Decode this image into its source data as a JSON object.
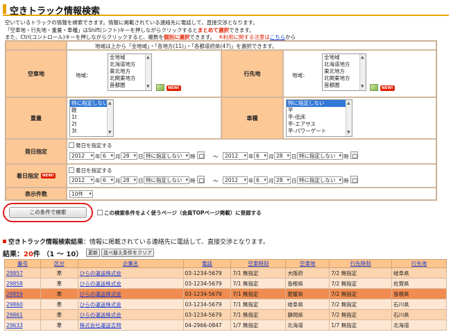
{
  "page_title": "空きトラック情報検索",
  "intro": {
    "line1": "空いているトラックの情報を検索できます。情報に掲載されている連絡先に電話して、直接交渉となります。",
    "line2_a": "「空車地・行先地・重量・車種」はShift(シフト)キーを押しながらクリックすると",
    "line2_b": "まとめて選択",
    "line2_c": "できます。",
    "line3_a": "また、Ctrl(コントロール)キーを押しながらクリックすると、複数を",
    "line3_b": "個別に選択",
    "line3_c": "できます。",
    "line3_note": "※利用に関する注意は",
    "line3_link": "こちら",
    "line3_end": "から"
  },
  "form": {
    "region_note": "地域は上から「全地域」・「各地方(11)」・「各都道府県(47)」を選択できます。",
    "new_badge": "NEW!",
    "origin": {
      "label": "空車地",
      "sub_label": "地域：",
      "options": [
        "全地域",
        "北海道地方",
        "東北地方",
        "北関東地方",
        "首都圏"
      ]
    },
    "destination": {
      "label": "行先地",
      "sub_label": "地域：",
      "options": [
        "全地域",
        "北海道地方",
        "東北地方",
        "北関東地方",
        "首都圏"
      ]
    },
    "weight": {
      "label": "重量",
      "options": [
        "特に指定しない",
        "軽",
        "1t",
        "2t",
        "3t"
      ],
      "selected": 0
    },
    "vehicle": {
      "label": "車種",
      "options": [
        "特に指定しない",
        "平",
        "平-低床",
        "平-エアサス",
        "平-パワーゲート"
      ],
      "selected": 0
    },
    "departure": {
      "label": "発日指定",
      "checkbox": "発日を指定する",
      "from": {
        "year": "2012",
        "month": "6",
        "day": "28",
        "time": "特に指定しない"
      },
      "to": {
        "year": "2012",
        "month": "6",
        "day": "28",
        "time": "特に指定しない"
      }
    },
    "arrival": {
      "label": "着日指定",
      "checkbox": "着日を指定する",
      "from": {
        "year": "2012",
        "month": "6",
        "day": "28",
        "time": "特に指定しない"
      },
      "to": {
        "year": "2012",
        "month": "6",
        "day": "28",
        "time": "特に指定しない"
      }
    },
    "units": {
      "year": "年",
      "month": "月",
      "day": "日",
      "hour": "時",
      "tilde": "～"
    },
    "count": {
      "label": "表示件数",
      "value": "10件"
    }
  },
  "search_button": "この条件で検索",
  "save_checkbox": "この検索条件をよく使うページ（会員TOPページ掲載）に登録する",
  "results": {
    "title_bold": "空きトラック情報検索結果",
    "title_rest": "：情報に掲載されている連絡先に電話して、直接交渉となります。",
    "count_prefix": "結果：",
    "count": "20",
    "count_unit": "件",
    "range": "（1 ～ 10）",
    "refresh": "更新",
    "clear_sort": "並べ替え条件をクリア",
    "headers": [
      "番号",
      "区分",
      "企業名",
      "電話",
      "空車時刻",
      "空車地",
      "行先時刻",
      "行先地"
    ],
    "rows": [
      [
        "29857",
        "準",
        "ひらの運送株式会",
        "03-1234-5679",
        "7/1 無指定",
        "大阪府",
        "7/2 無指定",
        "岐阜県"
      ],
      [
        "29858",
        "準",
        "ひらの運送株式会",
        "03-1234-5679",
        "7/1 無指定",
        "島根県",
        "7/2 無指定",
        "佐賀県"
      ],
      [
        "29859",
        "準",
        "ひらの運送株式会",
        "03-1234-5679",
        "7/1 無指定",
        "愛媛県",
        "7/2 無指定",
        "島根県"
      ],
      [
        "29860",
        "準",
        "ひらの運送株式会",
        "03-1234-5679",
        "7/1 無指定",
        "岐阜県",
        "7/2 無指定",
        "石川県"
      ],
      [
        "29861",
        "準",
        "ひらの運送株式会",
        "03-1234-5679",
        "7/1 無指定",
        "静岡県",
        "7/2 無指定",
        "石川県"
      ],
      [
        "29633",
        "準",
        "株式会社運送吉岡",
        "04-2966-0847",
        "1/7 無指定",
        "北海道",
        "1/7 無指定",
        "北海道"
      ]
    ]
  }
}
